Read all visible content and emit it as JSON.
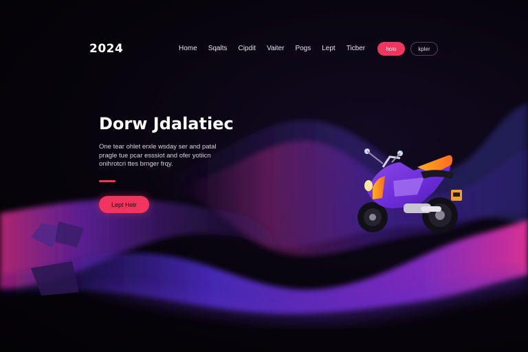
{
  "header": {
    "logo": "2024",
    "nav": [
      "Home",
      "Sqalts",
      "Cipdit",
      "Vaiter",
      "Pogs",
      "Lept",
      "Ticber"
    ],
    "primary_button": "hoio",
    "secondary_button": "kpler"
  },
  "hero": {
    "title": "Dorw Jdalatiec",
    "body_lines": [
      "One tear ohlet erxle wsday ser and patal",
      "pragle tue pcar esssiot and ofer yotiicn",
      "onihrotcri ttes brnger frqy."
    ],
    "cta_label": "Lept Hetr"
  },
  "colors": {
    "accent": "#f0365f",
    "background": "#050308",
    "wave_purple": "#6a2bd6",
    "wave_magenta": "#d42c8a"
  },
  "icons": {
    "hero_image": "motorcycle-icon"
  }
}
